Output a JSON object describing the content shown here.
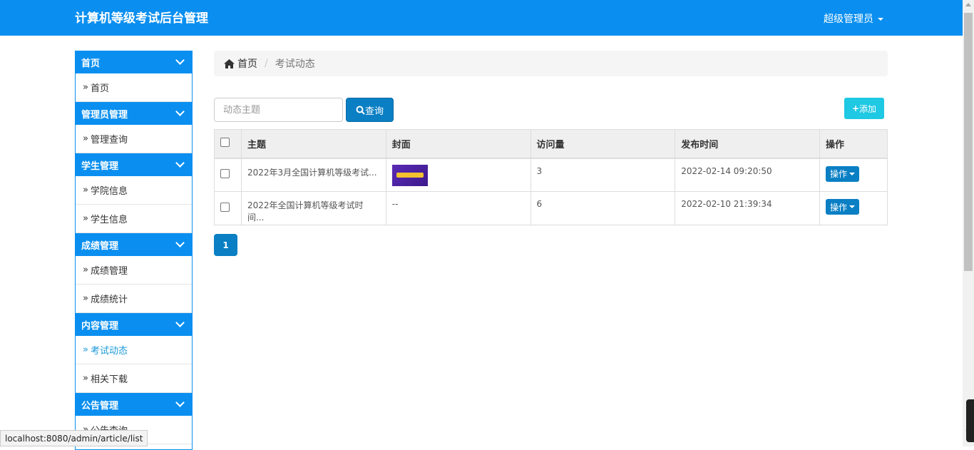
{
  "header": {
    "title": "计算机等级考试后台管理",
    "user": "超级管理员"
  },
  "sidebar": {
    "groups": [
      {
        "title": "首页",
        "items": [
          "首页"
        ]
      },
      {
        "title": "管理员管理",
        "items": [
          "管理查询"
        ]
      },
      {
        "title": "学生管理",
        "items": [
          "学院信息",
          "学生信息"
        ]
      },
      {
        "title": "成绩管理",
        "items": [
          "成绩管理",
          "成绩统计"
        ]
      },
      {
        "title": "内容管理",
        "items": [
          "考试动态",
          "相关下载"
        ],
        "active_item": "考试动态"
      },
      {
        "title": "公告管理",
        "items": [
          "公告查询"
        ]
      }
    ]
  },
  "breadcrumb": {
    "home": "首页",
    "current": "考试动态"
  },
  "search": {
    "placeholder": "动态主题",
    "value": "",
    "button": "查询"
  },
  "add_button": "添加",
  "table": {
    "headers": [
      "主题",
      "封面",
      "访问量",
      "发布时间",
      "操作"
    ],
    "rows": [
      {
        "title": "2022年3月全国计算机等级考试...",
        "cover": "image",
        "views": "3",
        "time": "2022-02-14 09:20:50",
        "action": "操作"
      },
      {
        "title": "2022年全国计算机等级考试时间...",
        "cover": "--",
        "views": "6",
        "time": "2022-02-10 21:39:34",
        "action": "操作"
      }
    ]
  },
  "pagination": {
    "current": "1"
  },
  "status_url": "localhost:8080/admin/article/list",
  "colors": {
    "primary": "#0a8ff0",
    "button": "#0a7fc4",
    "add": "#1fc8e3",
    "active_link": "#1a9ad8"
  }
}
